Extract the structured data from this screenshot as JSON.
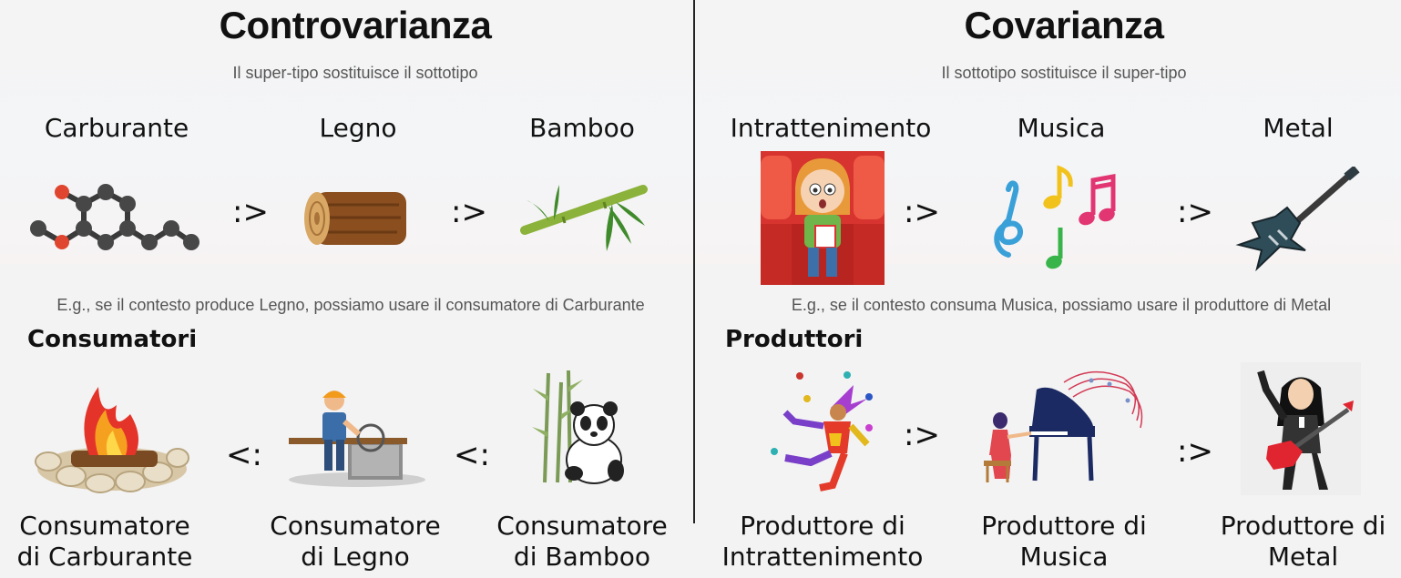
{
  "left": {
    "title": "Controvarianza",
    "subtitle": "Il super-tipo sostituisce il sottotipo",
    "top_labels": [
      "Carburante",
      "Legno",
      "Bamboo"
    ],
    "top_operator": ":>",
    "example": "E.g., se il contesto produce Legno, possiamo usare il consumatore di Carburante",
    "section": "Consumatori",
    "bottom_operator": "<:",
    "bottom_labels": [
      {
        "line1": "Consumatore",
        "line2": "di Carburante"
      },
      {
        "line1": "Consumatore",
        "line2": "di Legno"
      },
      {
        "line1": "Consumatore",
        "line2": "di Bamboo"
      }
    ]
  },
  "right": {
    "title": "Covarianza",
    "subtitle": "Il sottotipo sostituisce il super-tipo",
    "top_labels": [
      "Intrattenimento",
      "Musica",
      "Metal"
    ],
    "top_operator": ":>",
    "example": "E.g., se il contesto consuma Musica, possiamo usare il produttore di Metal",
    "section": "Produttori",
    "bottom_operator": ":>",
    "bottom_labels": [
      {
        "line1": "Produttore di",
        "line2": "Intrattenimento"
      },
      {
        "line1": "Produttore di",
        "line2": "Musica"
      },
      {
        "line1": "Produttore di",
        "line2": "Metal"
      }
    ]
  },
  "icons": {
    "carburante": "molecule-icon",
    "legno": "log-icon",
    "bamboo": "bamboo-icon",
    "intrattenimento": "cinema-viewer-icon",
    "musica": "music-notes-icon",
    "metal": "electric-guitar-icon",
    "consumatore_carburante": "campfire-icon",
    "consumatore_legno": "sawmill-worker-icon",
    "consumatore_bamboo": "panda-icon",
    "produttore_intrattenimento": "jester-icon",
    "produttore_musica": "pianist-icon",
    "produttore_metal": "metal-guitarist-icon"
  }
}
